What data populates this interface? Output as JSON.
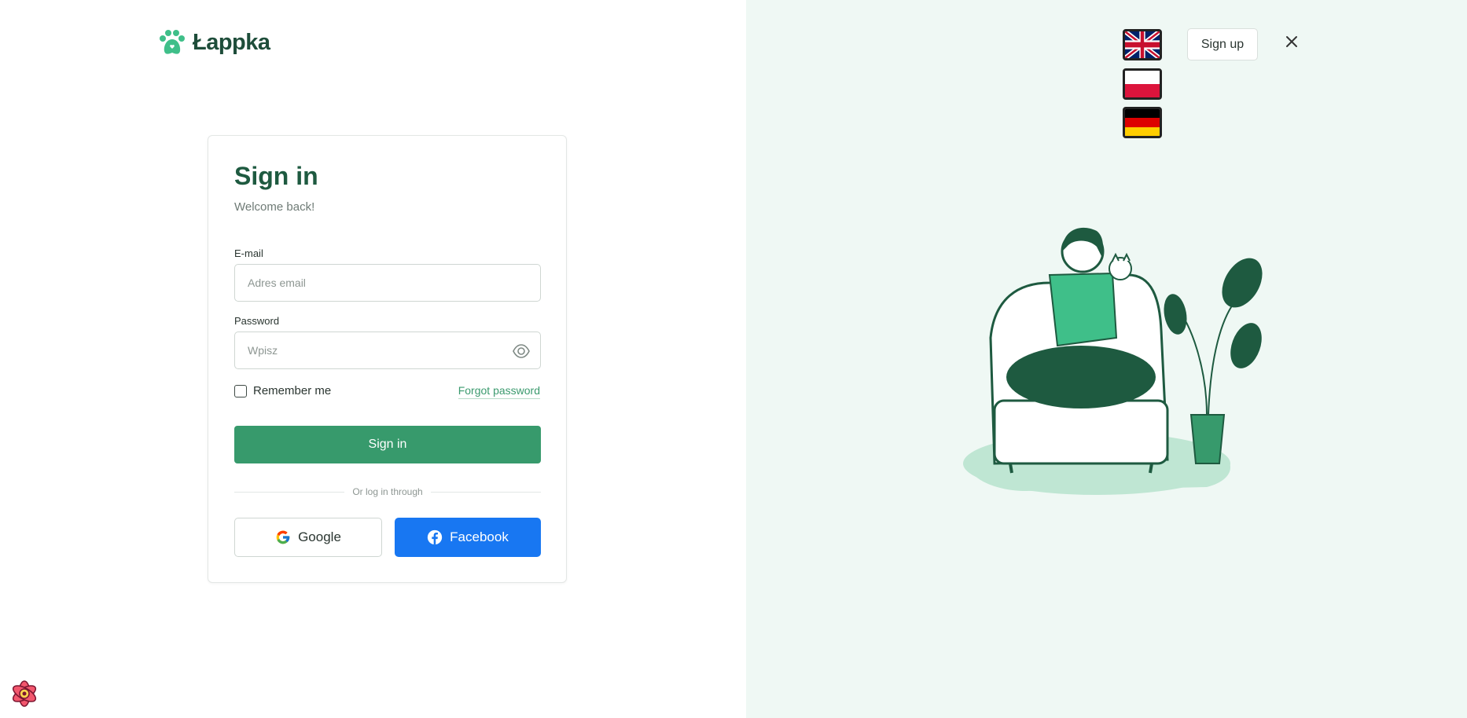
{
  "brand": {
    "name": "Łappka"
  },
  "header": {
    "signup_label": "Sign up",
    "languages": [
      "en-flag-icon",
      "pl-flag-icon",
      "de-flag-icon"
    ]
  },
  "form": {
    "title": "Sign in",
    "subtitle": "Welcome back!",
    "email": {
      "label": "E-mail",
      "placeholder": "Adres email",
      "value": ""
    },
    "password": {
      "label": "Password",
      "placeholder": "Wpisz",
      "value": ""
    },
    "remember_label": "Remember me",
    "remember_checked": false,
    "forgot_label": "Forgot password",
    "submit_label": "Sign in",
    "divider_text": "Or log in through",
    "google_label": "Google",
    "facebook_label": "Facebook"
  },
  "colors": {
    "accent": "#379a6c",
    "brand_dark": "#1e5a40",
    "right_bg": "#eff8f4",
    "facebook": "#1877f2"
  }
}
